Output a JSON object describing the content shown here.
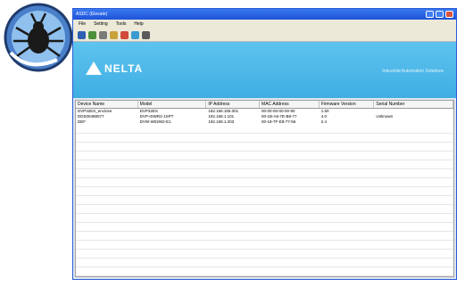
{
  "app": {
    "title": "ASDC (Elevate)",
    "banner_brand": "NELTA",
    "banner_tagline": "Industrial Automation Solutions"
  },
  "menu": [
    "File",
    "Setting",
    "Tools",
    "Help"
  ],
  "toolbar": {
    "buttons": [
      "save-icon",
      "refresh-icon",
      "search-icon",
      "settings-icon",
      "delete-icon",
      "info-icon",
      "config-icon"
    ]
  },
  "table": {
    "columns": [
      "Device Name",
      "Model",
      "IP Address",
      "MAC Address",
      "Firmware Version",
      "Serial Number"
    ],
    "rows": [
      [
        "DVP32ES_enclose",
        "DVP32ES",
        "192.168.155.001",
        "00-00-00-00-00-90",
        "1.50",
        ""
      ],
      [
        "DDS00488077",
        "DVP-ISWR2-1SPT",
        "192.168.1.101",
        "00-1B-A6-7E-B8-77",
        "4.0",
        "Unknown"
      ],
      [
        "DEF",
        "DVW-W02W2-E1",
        "192.168.1.203",
        "00-18-7F-E8-77-56",
        "2.4",
        ""
      ]
    ]
  },
  "colors": {
    "titlebar": "#2a5bd6",
    "banner": "#4fb8ea",
    "table_bg": "#ffffff"
  }
}
